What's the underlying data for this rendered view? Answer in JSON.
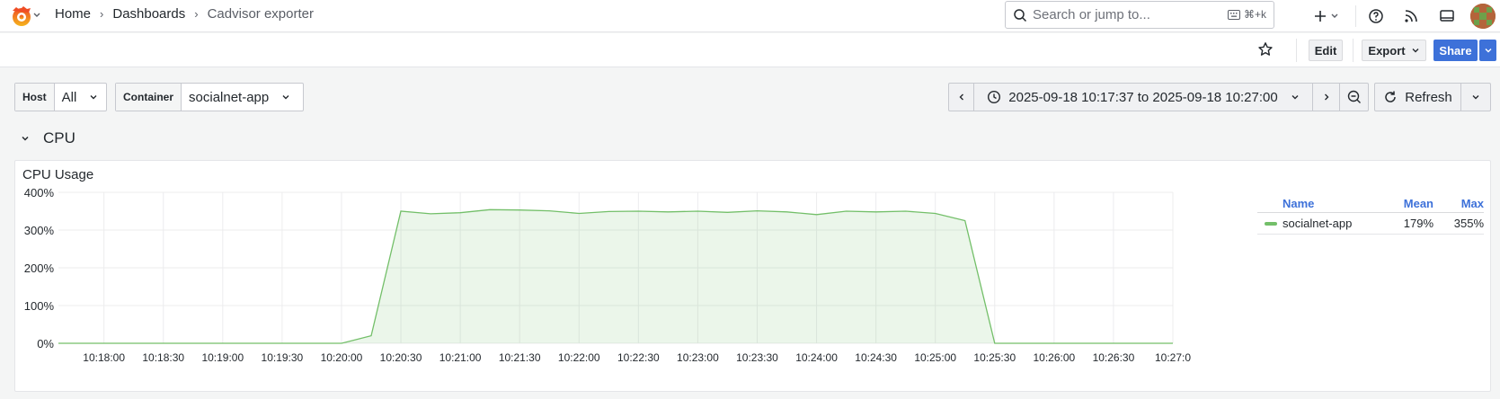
{
  "nav": {
    "breadcrumb": [
      "Home",
      "Dashboards",
      "Cadvisor exporter"
    ],
    "search_placeholder": "Search or jump to...",
    "search_shortcut": "⌘+k"
  },
  "toolbar": {
    "edit_label": "Edit",
    "export_label": "Export",
    "share_label": "Share"
  },
  "variables": [
    {
      "label": "Host",
      "value": "All"
    },
    {
      "label": "Container",
      "value": "socialnet-app"
    }
  ],
  "time_range": {
    "text": "2025-09-18 10:17:37 to 2025-09-18 10:27:00",
    "refresh_label": "Refresh"
  },
  "row": {
    "title": "CPU"
  },
  "panel": {
    "title": "CPU Usage",
    "legend": {
      "headers": {
        "name": "Name",
        "mean": "Mean",
        "max": "Max"
      },
      "rows": [
        {
          "name": "socialnet-app",
          "mean": "179%",
          "max": "355%",
          "color": "#73bf69"
        }
      ]
    }
  },
  "chart_data": {
    "type": "area",
    "y_ticks": [
      "400%",
      "300%",
      "200%",
      "100%",
      "0%"
    ],
    "ylim": [
      0,
      400
    ],
    "x_ticks": [
      "10:18:00",
      "10:18:30",
      "10:19:00",
      "10:19:30",
      "10:20:00",
      "10:20:30",
      "10:21:00",
      "10:21:30",
      "10:22:00",
      "10:22:30",
      "10:23:00",
      "10:23:30",
      "10:24:00",
      "10:24:30",
      "10:25:00",
      "10:25:30",
      "10:26:00",
      "10:26:30",
      "10:27:0"
    ],
    "xlim": [
      "10:17:37",
      "10:27:00"
    ],
    "grid": true,
    "series": [
      {
        "name": "socialnet-app",
        "color": "#73bf69",
        "points": [
          [
            "10:17:37",
            0
          ],
          [
            "10:18:00",
            0
          ],
          [
            "10:18:30",
            0
          ],
          [
            "10:19:00",
            0
          ],
          [
            "10:19:30",
            0
          ],
          [
            "10:20:00",
            0
          ],
          [
            "10:20:15",
            20
          ],
          [
            "10:20:30",
            350
          ],
          [
            "10:20:45",
            343
          ],
          [
            "10:21:00",
            346
          ],
          [
            "10:21:15",
            354
          ],
          [
            "10:21:30",
            353
          ],
          [
            "10:21:45",
            351
          ],
          [
            "10:22:00",
            344
          ],
          [
            "10:22:15",
            349
          ],
          [
            "10:22:30",
            350
          ],
          [
            "10:22:45",
            348
          ],
          [
            "10:23:00",
            350
          ],
          [
            "10:23:15",
            347
          ],
          [
            "10:23:30",
            351
          ],
          [
            "10:23:45",
            348
          ],
          [
            "10:24:00",
            341
          ],
          [
            "10:24:15",
            350
          ],
          [
            "10:24:30",
            348
          ],
          [
            "10:24:45",
            350
          ],
          [
            "10:25:00",
            344
          ],
          [
            "10:25:15",
            325
          ],
          [
            "10:25:30",
            0
          ],
          [
            "10:26:00",
            0
          ],
          [
            "10:26:30",
            0
          ],
          [
            "10:27:00",
            0
          ]
        ]
      }
    ]
  }
}
